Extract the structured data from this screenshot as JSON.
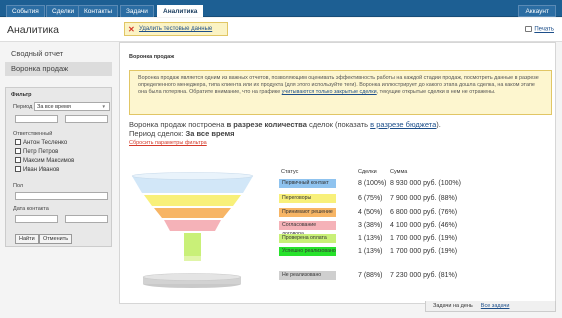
{
  "topbar": {
    "tabs": [
      {
        "label": "События"
      },
      {
        "label": "Сделки"
      },
      {
        "label": "Контакты"
      },
      {
        "label": "Задачи"
      },
      {
        "label": "Аналитика"
      }
    ],
    "account": "Аккаунт"
  },
  "header": {
    "title": "Аналитика",
    "delete_demo": "Удалить тестовые данные",
    "print": "Печать"
  },
  "sidebar": {
    "items": [
      {
        "label": "Сводный отчет"
      },
      {
        "label": "Воронка продаж"
      }
    ],
    "filter": {
      "title": "Фильтр",
      "period_label": "Период",
      "period_value": "За все время",
      "responsible_label": "Ответственный",
      "users": [
        "Антон Тесленко",
        "Петр Петров",
        "Максим Максимов",
        "Иван Иванов"
      ],
      "gender_label": "Пол",
      "contact_date_label": "Дата контакта",
      "find_button": "Найти",
      "cancel_button": "Отменить"
    }
  },
  "report": {
    "title": "Воронка продаж",
    "info_text": "Воронка продаж является одним из важных отчетов, позволяющим оценивать эффективность работы на каждой стадии продаж, посмотреть данные в разрезе определенного менеджера, типа клиента или их продукта (для этого используйте теги). Воронка иллюстрирует до какого этапа дошла сделка, на каком этапе она была потеряна. Обратите внимание, что на графике ",
    "info_link": "учитываются только закрытые сделки",
    "info_tail": ", текущие открытые сделки в нем не отражены.",
    "built_prefix": "Воронка продаж построена ",
    "built_bold": "в разрезе количества",
    "built_mid": " сделок (показать ",
    "built_link": "в разрезе бюджета",
    "built_end": ").",
    "period_prefix": "Период сделок: ",
    "period_value": "За все время",
    "reset": "Сбросить параметры фильтра",
    "col_status": "Статус",
    "col_deals": "Сделки",
    "col_sum": "Сумма",
    "stages": [
      {
        "name": "Первичный контакт",
        "deals": "8 (100%)",
        "sum": "8 930 000 руб. (100%)",
        "color": "#8fc3ef"
      },
      {
        "name": "Переговоры",
        "deals": "6 (75%)",
        "sum": "7 900 000 руб. (88%)",
        "color": "#f8f07a"
      },
      {
        "name": "Принимают решение",
        "deals": "4 (50%)",
        "sum": "6 800 000 руб. (76%)",
        "color": "#f7b565"
      },
      {
        "name": "Согласование договора",
        "deals": "3 (38%)",
        "sum": "4 100 000 руб. (46%)",
        "color": "#f5b2b8"
      },
      {
        "name": "Проверена оплата",
        "deals": "1 (13%)",
        "sum": "1 700 000 руб. (19%)",
        "color": "#c9f078"
      },
      {
        "name": "Успешно реализовано",
        "deals": "1 (13%)",
        "sum": "1 700 000 руб. (19%)",
        "color": "#27e22b"
      },
      {
        "name": "Не реализовано",
        "deals": "7 (88%)",
        "sum": "7 230 000 руб. (81%)",
        "color": "#cfcfcf"
      }
    ]
  },
  "footer": {
    "tasks_label": "Задачи на день",
    "all_tasks": "Все задачи"
  }
}
